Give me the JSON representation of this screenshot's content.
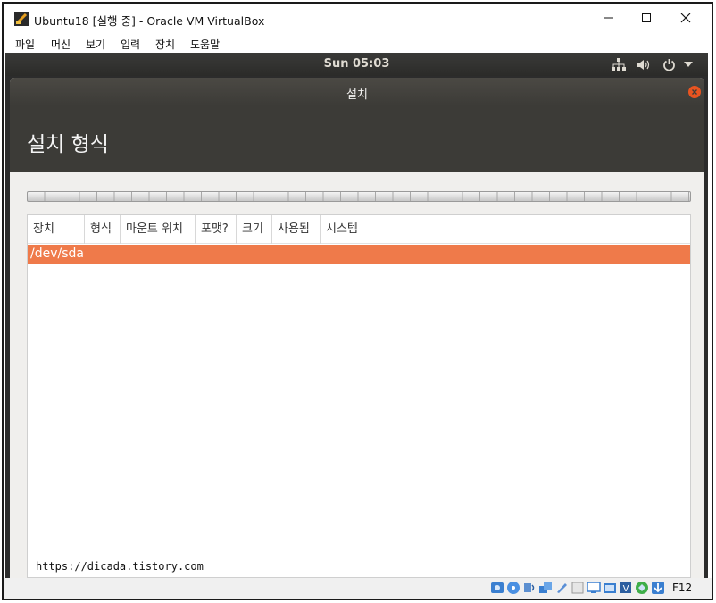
{
  "window": {
    "title": "Ubuntu18 [실행 중] - Oracle VM VirtualBox",
    "controls": {
      "minimize": "─",
      "maximize": "☐",
      "close": "✕"
    }
  },
  "menubar": {
    "items": [
      {
        "label": "파일"
      },
      {
        "label": "머신"
      },
      {
        "label": "보기"
      },
      {
        "label": "입력"
      },
      {
        "label": "장치"
      },
      {
        "label": "도움말"
      }
    ]
  },
  "ubuntu_topbar": {
    "clock": "Sun 05:03",
    "tray_icons": [
      "network-icon",
      "volume-icon",
      "power-icon",
      "chevron-down-icon"
    ]
  },
  "installer": {
    "window_title": "설치",
    "heading": "설치 형식",
    "table": {
      "columns": [
        "장치",
        "형식",
        "마운트 위치",
        "포맷?",
        "크기",
        "사용됨",
        "시스템"
      ],
      "rows": [
        {
          "device": "/dev/sda",
          "selected": true
        }
      ]
    },
    "accent_color": "#e95420",
    "selected_row_color": "#ef7a4a"
  },
  "watermark": "https://dicada.tistory.com",
  "statusbar": {
    "icons": [
      "hard-disk-icon",
      "optical-disk-icon",
      "audio-icon",
      "network-adapter-icon",
      "usb-icon",
      "shared-folder-icon",
      "display-icon",
      "video-capture-icon",
      "cpu-virtualization-icon",
      "mouse-integration-icon",
      "keyboard-capture-icon"
    ],
    "host_key": "F12"
  }
}
